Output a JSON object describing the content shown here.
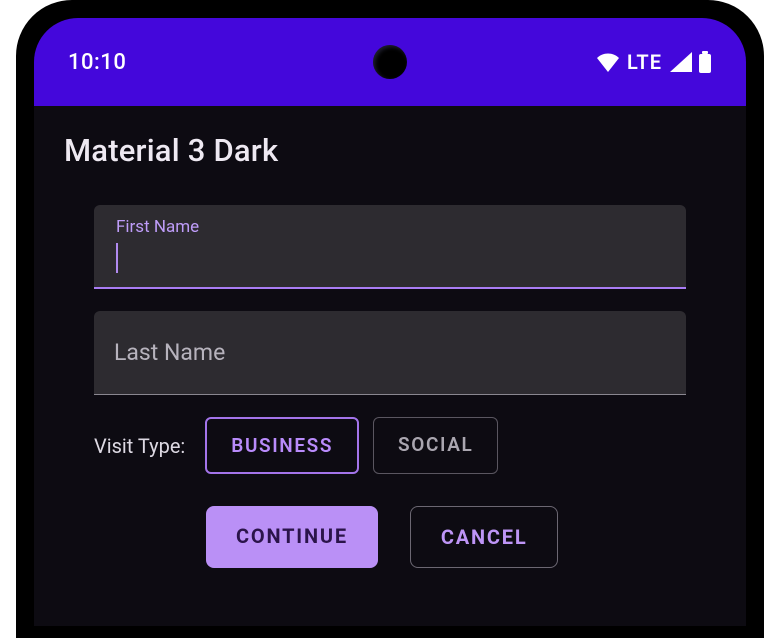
{
  "status": {
    "time": "10:10",
    "network_label": "LTE"
  },
  "title": "Material 3 Dark",
  "form": {
    "first_name": {
      "label": "First Name",
      "value": ""
    },
    "last_name": {
      "label": "Last Name",
      "value": ""
    },
    "visit_type_label": "Visit Type:",
    "visit_options": {
      "business": "BUSINESS",
      "social": "SOCIAL"
    },
    "selected_visit": "business"
  },
  "actions": {
    "continue": "CONTINUE",
    "cancel": "CANCEL"
  },
  "colors": {
    "accent": "#b98bfb",
    "status_bar": "#4407db",
    "surface": "#0d0b12",
    "field": "#2d2b30"
  }
}
